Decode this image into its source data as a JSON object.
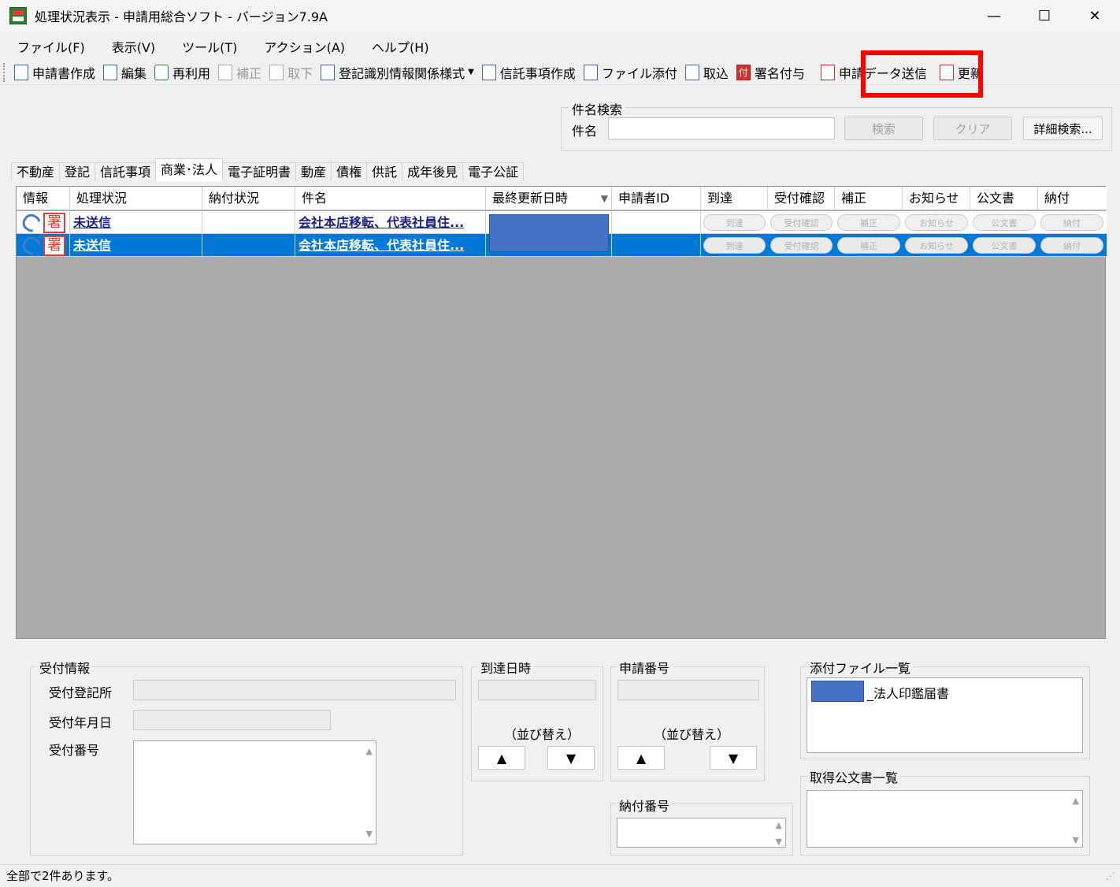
{
  "window": {
    "title": "処理状況表示 - 申請用総合ソフト - バージョン7.9A",
    "minimize": "—",
    "maximize": "☐",
    "close": "✕"
  },
  "menu": [
    "ファイル(F)",
    "表示(V)",
    "ツール(T)",
    "アクション(A)",
    "ヘルプ(H)"
  ],
  "toolbar": {
    "create": "申請書作成",
    "edit": "編集",
    "reuse": "再利用",
    "amend": "補正",
    "withdraw": "取下",
    "form": "登記識別情報関係様式",
    "trust": "信託事項作成",
    "attach": "ファイル添付",
    "import": "取込",
    "sign": "署名付与",
    "send": "申請データ送信",
    "refresh": "更新",
    "sign_icon_text": "付"
  },
  "search": {
    "group_title": "件名検索",
    "label": "件名",
    "value": "",
    "search_btn": "検索",
    "clear_btn": "クリア",
    "advanced_btn": "詳細検索..."
  },
  "tabs": [
    "不動産",
    "登記",
    "信託事項",
    "商業･法人",
    "電子証明書",
    "動産",
    "債権",
    "供託",
    "成年後見",
    "電子公証"
  ],
  "grid": {
    "headers": [
      "情報",
      "処理状況",
      "納付状況",
      "件名",
      "最終更新日時",
      "申請者ID",
      "到達",
      "受付確認",
      "補正",
      "お知らせ",
      "公文書",
      "納付"
    ],
    "rows": [
      {
        "status": "未送信",
        "payment": "",
        "subject": "会社本店移転、代表社員住...",
        "applicant": "",
        "arrive": "到達",
        "confirm": "受付確認",
        "amend": "補正",
        "notice": "お知らせ",
        "doc": "公文書",
        "pay": "納付"
      },
      {
        "status": "未送信",
        "payment": "",
        "subject": "会社本店移転、代表社員住...",
        "applicant": "",
        "arrive": "到達",
        "confirm": "受付確認",
        "amend": "補正",
        "notice": "お知らせ",
        "doc": "公文書",
        "pay": "納付"
      }
    ],
    "seal_text": "署",
    "sort_arrow": "▼"
  },
  "details": {
    "receipt_title": "受付情報",
    "office_label": "受付登記所",
    "date_label": "受付年月日",
    "number_label": "受付番号",
    "arrival_title": "到達日時",
    "sort_label": "（並び替え）",
    "app_no_title": "申請番号",
    "sort_label2": "（並び替え）",
    "payment_title": "納付番号",
    "up": "▲",
    "down": "▼",
    "attach_title": "添付ファイル一覧",
    "attach_item": "_法人印鑑届書",
    "docs_title": "取得公文書一覧"
  },
  "status": {
    "text": "全部で2件あります。"
  }
}
